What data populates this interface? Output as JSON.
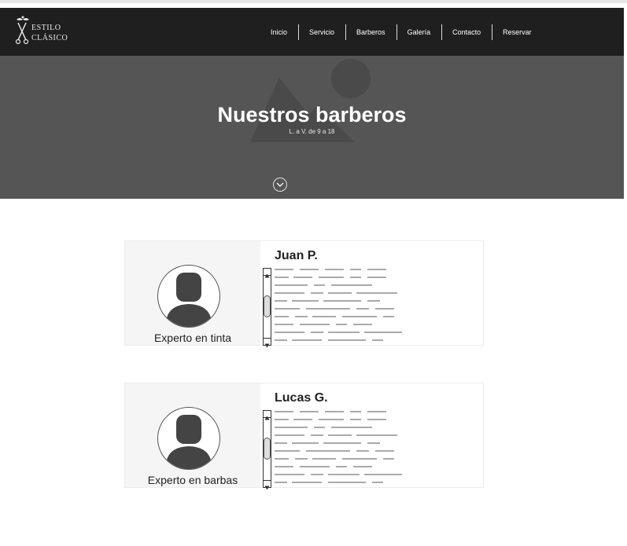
{
  "brand": {
    "line1": "ESTILO",
    "line2": "CLÁSICO"
  },
  "nav": {
    "items": [
      "Inicio",
      "Servicio",
      "Barberos",
      "Galería",
      "Contacto",
      "Reservar"
    ]
  },
  "hero": {
    "title": "Nuestros barberos",
    "subtitle": "L. a V. de 9 a 18"
  },
  "barbers": [
    {
      "name": "Juan P.",
      "specialty": "Experto en tinta"
    },
    {
      "name": "Lucas G.",
      "specialty": "Experto en barbas"
    }
  ],
  "colors": {
    "navbar": "#1f1f1f",
    "hero": "#555555",
    "card_left": "#f5f5f5",
    "placeholder_text": "#aaaaaa"
  },
  "icons": {
    "logo": "barber-scissors-mustache-icon",
    "hero": "image-placeholder-icon",
    "scroll": "chevron-down-icon",
    "avatar": "user-silhouette-icon"
  }
}
